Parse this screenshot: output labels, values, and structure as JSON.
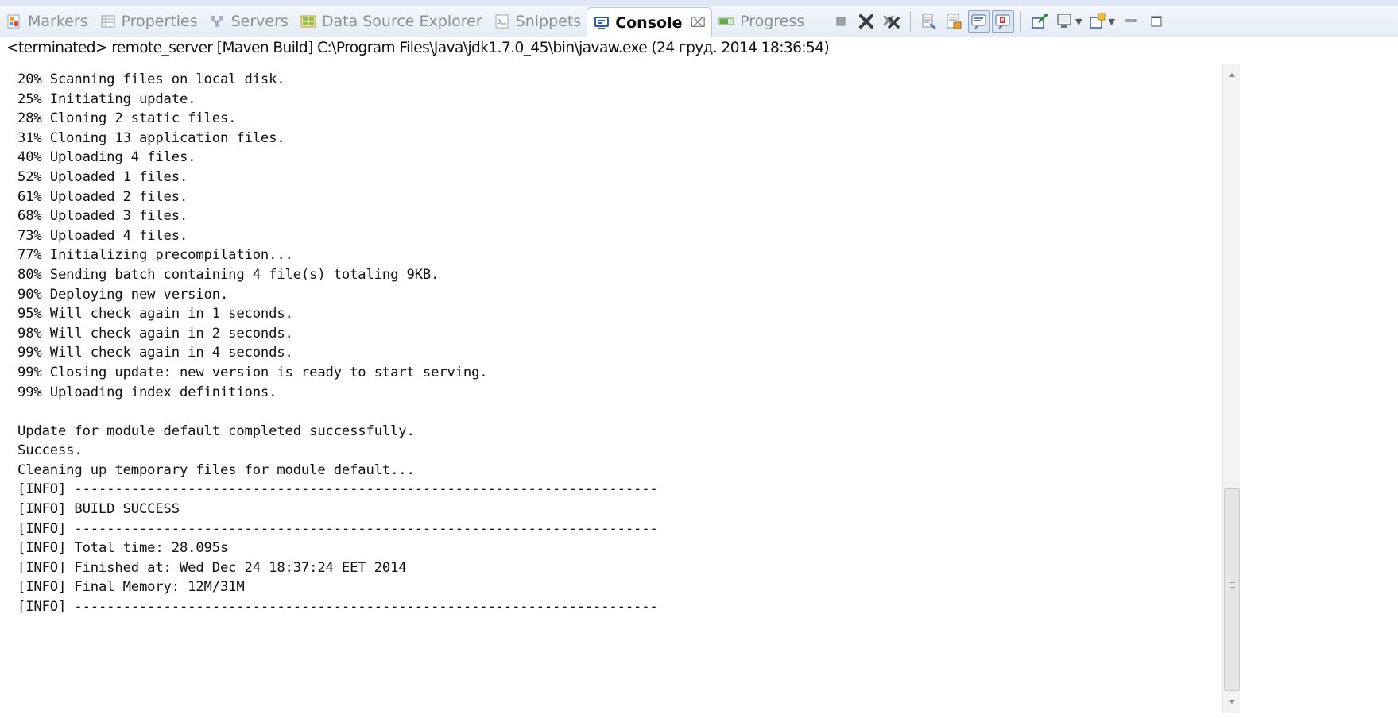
{
  "tabs": [
    {
      "label": "Markers",
      "icon": "markers-icon"
    },
    {
      "label": "Properties",
      "icon": "properties-icon"
    },
    {
      "label": "Servers",
      "icon": "servers-icon"
    },
    {
      "label": "Data Source Explorer",
      "icon": "data-source-explorer-icon"
    },
    {
      "label": "Snippets",
      "icon": "snippets-icon"
    },
    {
      "label": "Console",
      "icon": "console-icon",
      "active": true,
      "close": "⌧"
    },
    {
      "label": "Progress",
      "icon": "progress-icon"
    }
  ],
  "toolbar": [
    "terminate-icon",
    "remove-launch-icon",
    "remove-all-terminated-icon",
    "clear-console-icon",
    "scroll-lock-icon",
    "show-console-stdout-icon",
    "show-console-stderr-icon",
    "pin-console-icon",
    "display-selected-console-icon",
    "open-console-icon",
    "minimize-icon",
    "maximize-icon"
  ],
  "status": "<terminated> remote_server [Maven Build] C:\\Program Files\\Java\\jdk1.7.0_45\\bin\\javaw.exe (24 груд. 2014 18:36:54)",
  "console_lines": [
    "20% Scanning files on local disk.",
    "25% Initiating update.",
    "28% Cloning 2 static files.",
    "31% Cloning 13 application files.",
    "40% Uploading 4 files.",
    "52% Uploaded 1 files.",
    "61% Uploaded 2 files.",
    "68% Uploaded 3 files.",
    "73% Uploaded 4 files.",
    "77% Initializing precompilation...",
    "80% Sending batch containing 4 file(s) totaling 9KB.",
    "90% Deploying new version.",
    "95% Will check again in 1 seconds.",
    "98% Will check again in 2 seconds.",
    "99% Will check again in 4 seconds.",
    "99% Closing update: new version is ready to start serving.",
    "99% Uploading index definitions.",
    "",
    "Update for module default completed successfully.",
    "Success.",
    "Cleaning up temporary files for module default...",
    "[INFO] ------------------------------------------------------------------------",
    "[INFO] BUILD SUCCESS",
    "[INFO] ------------------------------------------------------------------------",
    "[INFO] Total time: 28.095s",
    "[INFO] Finished at: Wed Dec 24 18:37:24 EET 2014",
    "[INFO] Final Memory: 12M/31M",
    "[INFO] ------------------------------------------------------------------------"
  ]
}
